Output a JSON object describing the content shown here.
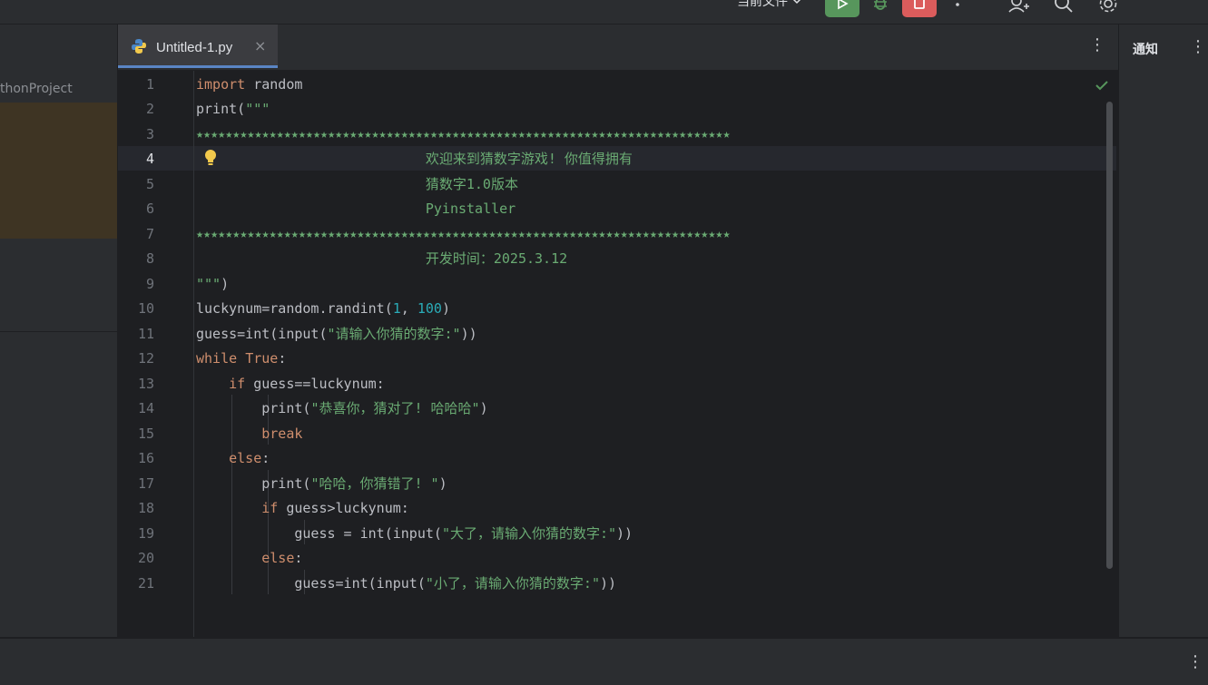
{
  "toolbar": {
    "run_config": "当前文件",
    "icons": [
      "run-icon",
      "debug-icon",
      "stop-icon",
      "more-icon",
      "add-user-icon",
      "search-icon",
      "settings-icon"
    ]
  },
  "project": {
    "name": "thonProject"
  },
  "editor": {
    "tab": {
      "filename": "Untitled-1.py",
      "close": "×"
    },
    "current_line": 4,
    "line_numbers": [
      "1",
      "2",
      "3",
      "4",
      "5",
      "6",
      "7",
      "8",
      "9",
      "10",
      "11",
      "12",
      "13",
      "14",
      "15",
      "16",
      "17",
      "18",
      "19",
      "20",
      "21"
    ],
    "code": {
      "l1_kw": "import",
      "l1_rest": " random",
      "l2_fn": "print(",
      "l2_str": "\"\"\"",
      "l3": "★★★★★★★★★★★★★★★★★★★★★★★★★★★★★★★★★★★★★★★★★★★★★★★★★★★★★★★★★★★★★★★★★★★★★★★★★",
      "l4": "                            欢迎来到猜数字游戏! 你值得拥有",
      "l5": "                            猜数字1.0版本",
      "l6": "                            Pyinstaller",
      "l7": "★★★★★★★★★★★★★★★★★★★★★★★★★★★★★★★★★★★★★★★★★★★★★★★★★★★★★★★★★★★★★★★★★★★★★★★★★",
      "l8": "                            开发时间：2025.3.12",
      "l9_str": "\"\"\"",
      "l9_rest": ")",
      "l10_a": "luckynum=random.randint(",
      "l10_n1": "1",
      "l10_b": ", ",
      "l10_n2": "100",
      "l10_c": ")",
      "l11_a": "guess=int(input(",
      "l11_str": "\"请输入你猜的数字:\"",
      "l11_b": "))",
      "l12_kw": "while",
      "l12_sp": " ",
      "l12_kw2": "True",
      "l12_b": ":",
      "l13_ind": "    ",
      "l13_kw": "if",
      "l13_rest": " guess==luckynum:",
      "l14_ind": "        ",
      "l14_a": "print(",
      "l14_str": "\"恭喜你，猜对了! 哈哈哈\"",
      "l14_b": ")",
      "l15_ind": "        ",
      "l15_kw": "break",
      "l16_ind": "    ",
      "l16_kw": "else",
      "l16_b": ":",
      "l17_ind": "        ",
      "l17_a": "print(",
      "l17_str": "\"哈哈，你猜错了! \"",
      "l17_b": ")",
      "l18_ind": "        ",
      "l18_kw": "if",
      "l18_rest": " guess>luckynum:",
      "l19_ind": "            ",
      "l19_a": "guess = int(input(",
      "l19_str": "\"大了，请输入你猜的数字:\"",
      "l19_b": "))",
      "l20_ind": "        ",
      "l20_kw": "else",
      "l20_b": ":",
      "l21_ind": "            ",
      "l21_a": "guess=int(input(",
      "l21_str": "\"小了，请输入你猜的数字:\"",
      "l21_b": "))"
    }
  },
  "notifications": {
    "title": "通知",
    "menu": "⋮"
  },
  "status": {
    "menu": "⋮"
  },
  "colors": {
    "keyword": "#cf8e6d",
    "string": "#6aab73",
    "number": "#2aacb8",
    "run_button": "#57965c",
    "stop_button": "#db5c5c",
    "tab_underline": "#5a85c4"
  }
}
